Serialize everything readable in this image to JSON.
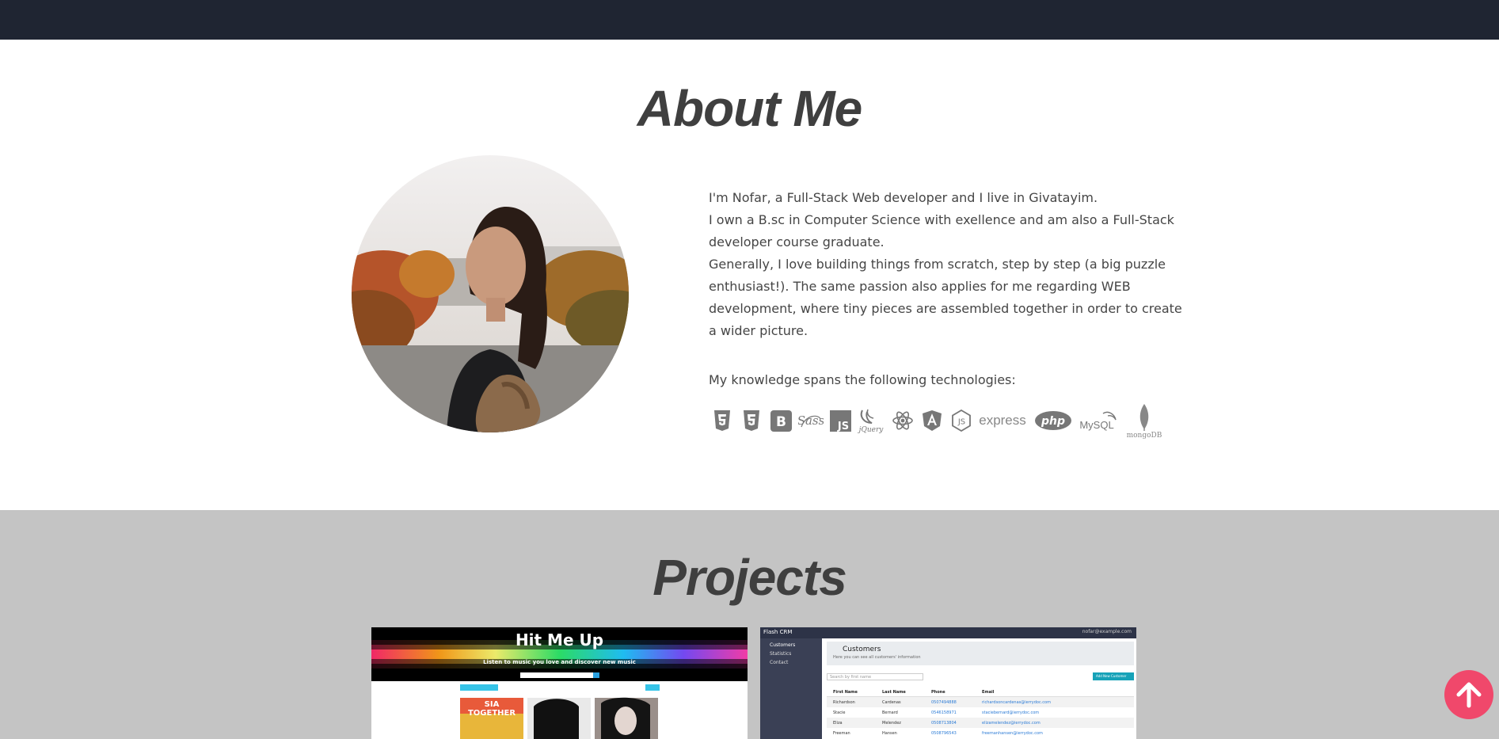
{
  "about": {
    "title": "About Me",
    "bio_lines": [
      "I'm Nofar, a Full-Stack Web developer and I live in Givatayim.",
      "I own a B.sc in Computer Science with exellence and am also a Full-Stack developer course graduate.",
      "Generally, I love building things from scratch, step by step (a big puzzle enthusiast!). The same passion also applies for me regarding WEB development, where tiny pieces are assembled together in order to create a wider picture."
    ],
    "knowledge_text": "My knowledge spans the following technologies:",
    "technologies": [
      {
        "name": "html5-icon"
      },
      {
        "name": "css3-icon"
      },
      {
        "name": "bootstrap-icon"
      },
      {
        "name": "sass-icon",
        "label": "Sass"
      },
      {
        "name": "javascript-icon",
        "label": "JS"
      },
      {
        "name": "jquery-icon",
        "label": "jQuery"
      },
      {
        "name": "react-icon"
      },
      {
        "name": "angular-icon"
      },
      {
        "name": "nodejs-icon",
        "label": "JS"
      },
      {
        "name": "express-icon",
        "label": "express"
      },
      {
        "name": "php-icon",
        "label": "php"
      },
      {
        "name": "mysql-icon",
        "label": "MySQL"
      },
      {
        "name": "mongodb-icon",
        "label": "mongoDB"
      }
    ]
  },
  "projects": {
    "title": "Projects",
    "items": [
      {
        "name": "hit-me-up",
        "heading": "Hit Me Up",
        "tagline": "Listen to music you love and discover new music",
        "album_text": "SIA TOGETHER"
      },
      {
        "name": "crm",
        "brand": "Flash CRM",
        "user": "nofar@example.com",
        "sidebar": [
          "Customers",
          "Statistics",
          "Contact"
        ],
        "page_title": "Customers",
        "page_subtitle": "Here you can see all customers' information",
        "search_placeholder": "Search by first name",
        "add_button": "Add New Customer",
        "columns": [
          "First Name",
          "Last Name",
          "Phone",
          "Email"
        ],
        "rows": [
          [
            "Richardson",
            "Cardenas",
            "0507494888",
            "richardsoncardenas@ierrydoc.com"
          ],
          [
            "Stacie",
            "Bernard",
            "0546158971",
            "staciebernard@ierrydoc.com"
          ],
          [
            "Eliza",
            "Melendez",
            "0508713804",
            "elizamelendez@ierrydoc.com"
          ],
          [
            "Freeman",
            "Hansen",
            "0508796543",
            "freemanhansen@ierrydoc.com"
          ]
        ]
      }
    ]
  },
  "colors": {
    "topbar": "#1f2532",
    "projects_bg": "#c4c4c4",
    "scroll_button": "#f0486b",
    "heading": "#3f3f3f"
  },
  "scroll_top_icon": "arrow-up-icon"
}
